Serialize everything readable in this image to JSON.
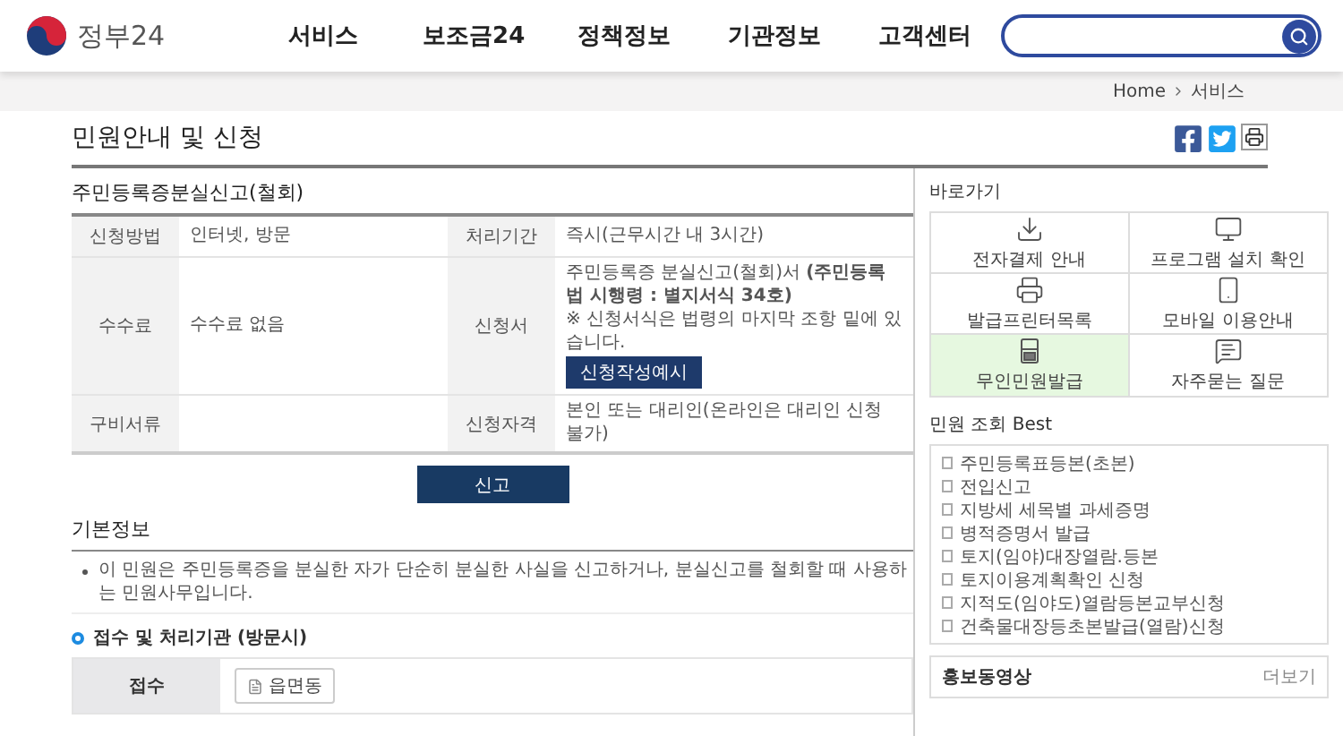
{
  "header": {
    "logo_text": "정부24",
    "nav": [
      {
        "label": "서비스"
      },
      {
        "label": "보조금24"
      },
      {
        "label": "정책정보"
      },
      {
        "label": "기관정보"
      },
      {
        "label": "고객센터"
      }
    ]
  },
  "breadcrumb": [
    "Home",
    "서비스"
  ],
  "page_title": "민원안내 및 신청",
  "service": {
    "title": "주민등록증분실신고(철회)",
    "rows": [
      {
        "cells": [
          {
            "label": "신청방법",
            "value": "인터넷, 방문"
          },
          {
            "label": "처리기간",
            "value": "즉시(근무시간 내 3시간)"
          }
        ]
      },
      {
        "cells": [
          {
            "label": "수수료",
            "value": "수수료 없음"
          },
          {
            "label": "신청서",
            "value": "주민등록증 분실신고(철회)서 **(주민등록법 시행령 : 별지서식 34호)**",
            "note": "※ 신청서식은 법령의 마지막 조항 밑에 있습니다.",
            "button": "신청작성예시"
          }
        ]
      },
      {
        "cells": [
          {
            "label": "구비서류"
          },
          {
            "label": "신청자격",
            "value": "본인 또는 대리인(온라인은 대리인 신청 불가)"
          }
        ]
      }
    ],
    "apply_button": "신고"
  },
  "basic_info": {
    "title": "기본정보",
    "bullets": [
      "이 민원은 주민등록증을 분실한 자가 단순히 분실한 사실을 신고하거나, 분실신고를 철회할 때 사용하는 민원사무입니다."
    ]
  },
  "reception": {
    "title": "접수 및 처리기관 (방문시)",
    "rows": [
      {
        "label": "접수",
        "chips": [
          "읍면동"
        ]
      }
    ]
  },
  "sidebar": {
    "quick_links": {
      "title": "바로가기",
      "items": [
        {
          "label": "전자결제 안내",
          "kind": "download",
          "selected": false
        },
        {
          "label": "프로그램 설치 확인",
          "kind": "monitor",
          "selected": false
        },
        {
          "label": "발급프린터목록",
          "kind": "printer",
          "selected": false
        },
        {
          "label": "모바일 이용안내",
          "kind": "mobile",
          "selected": false
        },
        {
          "label": "무인민원발급",
          "kind": "kiosk",
          "selected": true
        },
        {
          "label": "자주묻는 질문",
          "kind": "faq",
          "selected": false
        }
      ]
    },
    "best": {
      "title": "민원 조회 Best",
      "items": [
        "주민등록표등본(초본)",
        "전입신고",
        "지방세 세목별 과세증명",
        "병적증명서 발급",
        "토지(임야)대장열람.등본",
        "토지이용계획확인 신청",
        "지적도(임야도)열람등본교부신청",
        "건축물대장등초본발급(열람)신청"
      ]
    },
    "video": {
      "title": "홍보동영상",
      "more": "더보기"
    }
  }
}
